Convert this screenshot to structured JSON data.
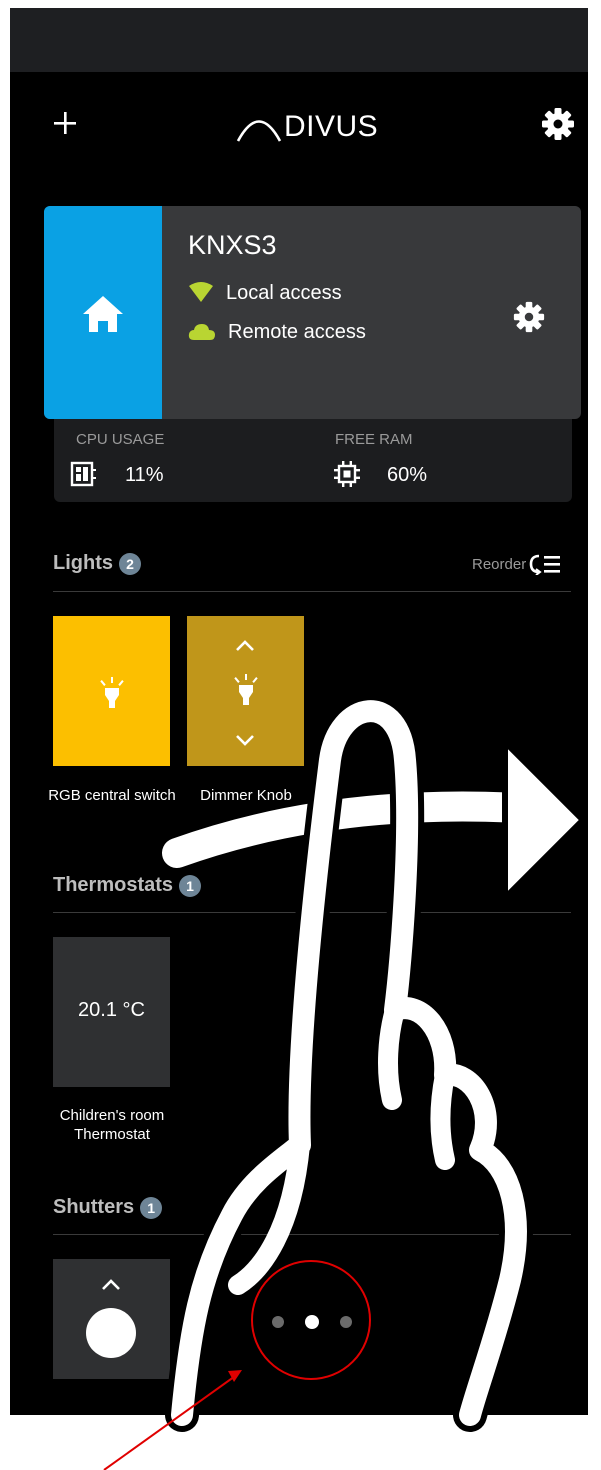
{
  "header": {
    "logo_text": "DIVUS"
  },
  "server": {
    "name": "KNXS3",
    "local_access": "Local access",
    "remote_access": "Remote access"
  },
  "stats": {
    "cpu_label": "CPU USAGE",
    "cpu_value": "11%",
    "ram_label": "FREE RAM",
    "ram_value": "60%"
  },
  "lights": {
    "title": "Lights",
    "count": "2",
    "reorder_label": "Reorder",
    "tiles": [
      {
        "label": "RGB central switch"
      },
      {
        "label": "Dimmer Knob"
      }
    ]
  },
  "thermostats": {
    "title": "Thermostats",
    "count": "1",
    "tiles": [
      {
        "label": "Children's room Thermostat",
        "value": "20.1 °C"
      }
    ]
  },
  "shutters": {
    "title": "Shutters",
    "count": "1"
  },
  "colors": {
    "accent_blue": "#0aa1e4",
    "light_yellow": "#fcbf00",
    "dimmer_gold": "#c0961a",
    "status_green": "#b9d532",
    "annotation_red": "#e00000"
  },
  "pager": {
    "page_count": 3,
    "active_index": 1
  },
  "icons": [
    "plus-icon",
    "gear-icon",
    "home-icon",
    "wifi-icon",
    "cloud-icon",
    "cpu-icon",
    "chip-icon",
    "reorder-icon",
    "bulb-icon",
    "chevron-up-icon",
    "chevron-down-icon",
    "swipe-arrow-icon",
    "hand-pointer-icon"
  ]
}
